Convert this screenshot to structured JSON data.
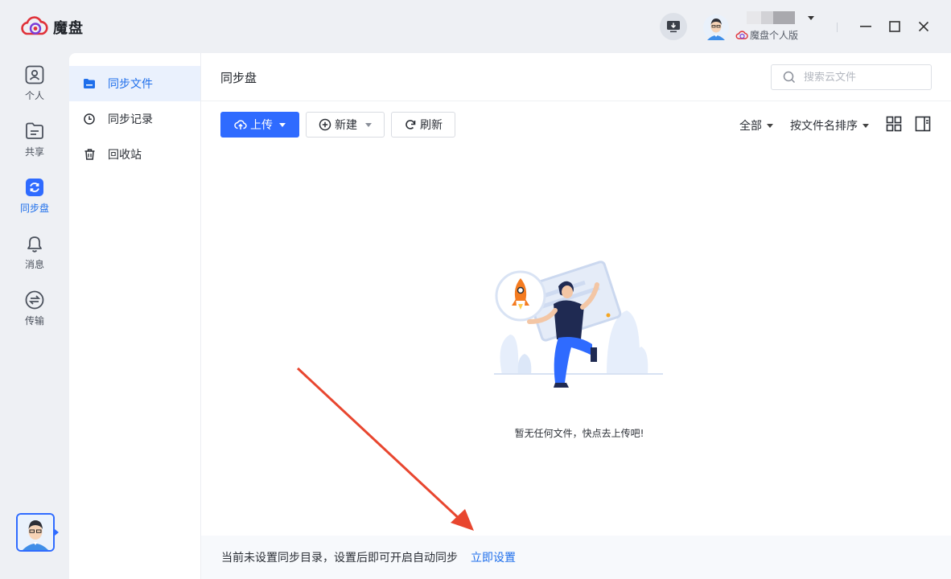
{
  "app": {
    "name": "魔盘"
  },
  "user": {
    "edition": "魔盘个人版"
  },
  "rail": {
    "items": [
      {
        "label": "个人",
        "icon": "person-icon"
      },
      {
        "label": "共享",
        "icon": "share-folder-icon"
      },
      {
        "label": "同步盘",
        "icon": "sync-icon",
        "active": true
      },
      {
        "label": "消息",
        "icon": "bell-icon"
      },
      {
        "label": "传输",
        "icon": "transfer-icon"
      }
    ]
  },
  "subnav": {
    "items": [
      {
        "label": "同步文件",
        "icon": "folder-icon",
        "active": true
      },
      {
        "label": "同步记录",
        "icon": "clock-icon"
      },
      {
        "label": "回收站",
        "icon": "trash-icon"
      }
    ]
  },
  "main": {
    "title": "同步盘",
    "search_placeholder": "搜索云文件",
    "toolbar": {
      "upload": "上传",
      "new": "新建",
      "refresh": "刷新"
    },
    "filter": {
      "scope": "全部",
      "sort": "按文件名排序"
    },
    "empty_text": "暂无任何文件，快点去上传吧!"
  },
  "footer": {
    "notice": "当前未设置同步目录，设置后即可开启自动同步",
    "link": "立即设置"
  },
  "colors": {
    "accent": "#2f6bff",
    "link": "#1f6feb",
    "annotation_arrow": "#e8462f"
  }
}
